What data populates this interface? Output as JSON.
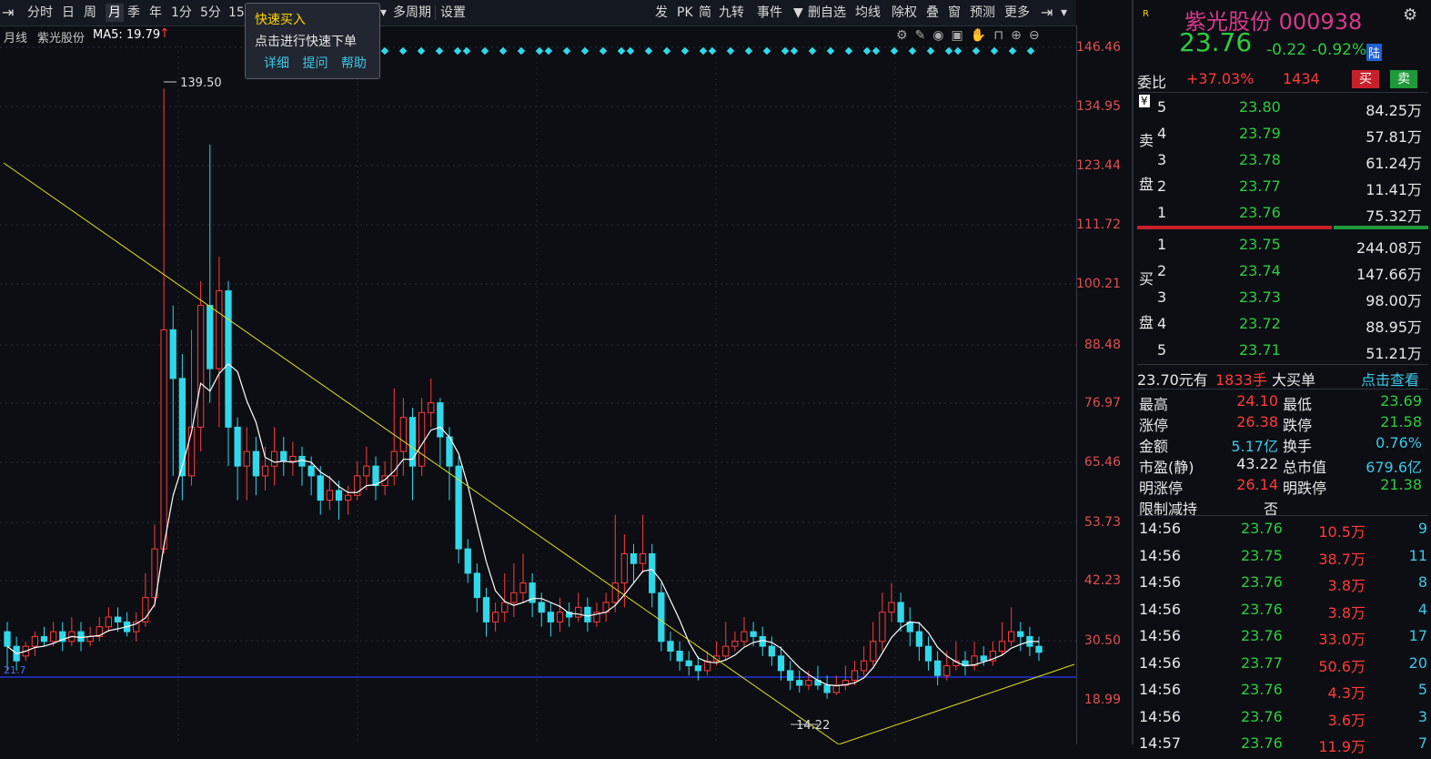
{
  "toolbar": {
    "left_items": [
      "分时",
      "日",
      "周",
      "月",
      "季",
      "年",
      "1分",
      "5分",
      "15"
    ],
    "active_index": 3,
    "mid_items": [
      "多周期",
      "设置"
    ],
    "right_items": [
      "发",
      "PK",
      "简",
      "九转",
      "事件",
      "▼",
      "删自选",
      "均线",
      "除权",
      "叠",
      "窗",
      "预测",
      "更多"
    ]
  },
  "popup": {
    "title": "快速买入",
    "text": "点击进行快速下单",
    "links": [
      "详细",
      "提问",
      "帮助"
    ]
  },
  "info": {
    "period": "月线",
    "stock": "紫光股份",
    "ma": "MA5: 19.79"
  },
  "axis": {
    "ticks": [
      "146.46",
      "134.95",
      "123.44",
      "111.72",
      "100.21",
      "88.48",
      "76.97",
      "65.46",
      "53.73",
      "42.23",
      "30.50",
      "18.99"
    ]
  },
  "annotations": {
    "high": "139.50",
    "low": "14.22",
    "left_price": "21.7"
  },
  "chart_data": {
    "type": "candlestick",
    "ylim": [
      14.0,
      148.0
    ],
    "grid": true,
    "candles": [
      [
        28,
        25,
        30,
        20
      ],
      [
        25,
        22,
        27,
        20
      ],
      [
        23,
        25,
        26,
        22
      ],
      [
        25,
        27,
        28,
        23
      ],
      [
        27,
        26,
        29,
        25
      ],
      [
        26,
        28,
        30,
        25
      ],
      [
        28,
        26,
        30,
        24
      ],
      [
        26,
        28,
        31,
        25
      ],
      [
        28,
        26,
        30,
        24
      ],
      [
        26,
        27,
        29,
        25
      ],
      [
        27,
        29,
        31,
        26
      ],
      [
        29,
        31,
        33,
        28
      ],
      [
        31,
        30,
        33,
        28
      ],
      [
        30,
        28,
        32,
        27
      ],
      [
        28,
        30,
        32,
        26
      ],
      [
        30,
        35,
        40,
        29
      ],
      [
        35,
        45,
        50,
        33
      ],
      [
        45,
        90,
        139.5,
        44
      ],
      [
        90,
        80,
        95,
        60
      ],
      [
        80,
        60,
        85,
        55
      ],
      [
        60,
        70,
        90,
        58
      ],
      [
        70,
        95,
        100,
        65
      ],
      [
        95,
        82,
        128,
        75
      ],
      [
        82,
        98,
        105,
        70
      ],
      [
        98,
        70,
        100,
        62
      ],
      [
        70,
        62,
        72,
        55
      ],
      [
        62,
        65,
        70,
        55
      ],
      [
        65,
        60,
        68,
        56
      ],
      [
        60,
        62,
        66,
        57
      ],
      [
        62,
        65,
        70,
        58
      ],
      [
        65,
        63,
        68,
        60
      ],
      [
        63,
        64,
        67,
        60
      ],
      [
        64,
        62,
        66,
        58
      ],
      [
        62,
        60,
        64,
        56
      ],
      [
        60,
        55,
        62,
        52
      ],
      [
        55,
        57,
        60,
        53
      ],
      [
        57,
        55,
        59,
        51
      ],
      [
        55,
        56,
        58,
        52
      ],
      [
        56,
        60,
        63,
        55
      ],
      [
        60,
        62,
        66,
        57
      ],
      [
        62,
        58,
        64,
        55
      ],
      [
        58,
        60,
        63,
        56
      ],
      [
        60,
        65,
        78,
        58
      ],
      [
        65,
        72,
        76,
        60
      ],
      [
        72,
        62,
        74,
        55
      ],
      [
        62,
        73,
        76,
        60
      ],
      [
        73,
        75,
        80,
        70
      ],
      [
        75,
        68,
        76,
        62
      ],
      [
        68,
        62,
        70,
        55
      ],
      [
        62,
        45,
        64,
        42
      ],
      [
        45,
        40,
        47,
        38
      ],
      [
        40,
        35,
        42,
        32
      ],
      [
        35,
        30,
        37,
        27
      ],
      [
        30,
        32,
        34,
        28
      ],
      [
        32,
        34,
        40,
        30
      ],
      [
        34,
        36,
        42,
        31
      ],
      [
        36,
        38,
        44,
        34
      ],
      [
        38,
        34,
        40,
        31
      ],
      [
        34,
        32,
        36,
        29
      ],
      [
        32,
        30,
        34,
        27
      ],
      [
        30,
        32,
        35,
        28
      ],
      [
        32,
        31,
        34,
        29
      ],
      [
        31,
        33,
        36,
        30
      ],
      [
        33,
        30,
        35,
        28
      ],
      [
        30,
        32,
        34,
        29
      ],
      [
        32,
        34,
        36,
        30
      ],
      [
        34,
        38,
        52,
        32
      ],
      [
        38,
        44,
        48,
        33
      ],
      [
        44,
        42,
        46,
        38
      ],
      [
        42,
        44,
        52,
        40
      ],
      [
        44,
        36,
        46,
        33
      ],
      [
        36,
        26,
        38,
        24
      ],
      [
        26,
        24,
        28,
        22
      ],
      [
        24,
        22,
        26,
        20
      ],
      [
        22,
        21,
        24,
        19
      ],
      [
        21,
        20,
        23,
        18
      ],
      [
        20,
        22,
        24,
        19
      ],
      [
        22,
        23,
        26,
        21
      ],
      [
        23,
        25,
        30,
        22
      ],
      [
        25,
        26,
        28,
        24
      ],
      [
        26,
        28,
        31,
        25
      ],
      [
        28,
        27,
        30,
        25
      ],
      [
        27,
        25,
        29,
        23
      ],
      [
        25,
        23,
        27,
        21
      ],
      [
        23,
        20,
        25,
        18
      ],
      [
        20,
        18,
        22,
        16
      ],
      [
        18,
        17,
        20,
        15.5
      ],
      [
        17,
        18,
        20,
        16
      ],
      [
        18,
        17,
        21,
        16
      ],
      [
        17,
        15.5,
        19,
        14.22
      ],
      [
        15.5,
        17,
        19,
        15
      ],
      [
        17,
        18,
        21,
        16
      ],
      [
        18,
        20,
        22,
        17
      ],
      [
        20,
        22,
        25,
        19
      ],
      [
        22,
        26,
        30,
        21
      ],
      [
        26,
        32,
        36,
        24
      ],
      [
        32,
        34,
        38,
        30
      ],
      [
        34,
        30,
        36,
        28
      ],
      [
        30,
        28,
        33,
        25
      ],
      [
        28,
        25,
        30,
        22
      ],
      [
        25,
        22,
        27,
        20
      ],
      [
        22,
        19,
        24,
        17
      ],
      [
        19,
        21,
        24,
        18
      ],
      [
        21,
        22,
        26,
        20
      ],
      [
        22,
        21,
        24,
        19
      ],
      [
        21,
        23,
        26,
        20
      ],
      [
        23,
        22,
        25,
        21
      ],
      [
        22,
        24,
        26,
        21
      ],
      [
        24,
        26,
        30,
        23
      ],
      [
        26,
        28,
        33,
        25
      ],
      [
        28,
        27,
        30,
        24
      ],
      [
        27,
        25,
        29,
        23
      ],
      [
        25,
        23.76,
        27,
        22
      ]
    ]
  },
  "quote": {
    "name": "紫光股份 000938",
    "price": "23.76",
    "change": "-0.22",
    "pct": "-0.92%",
    "market_tag": "陆",
    "weibi_label": "委比",
    "weibi": "+37.03%",
    "weicha": "1434",
    "buy_btn": "买",
    "sell_btn": "卖",
    "sell_side_labels": [
      "卖",
      "盘"
    ],
    "buy_side_labels": [
      "买",
      "盘"
    ],
    "sells": [
      {
        "lvl": "5",
        "price": "23.80",
        "vol": "84.25万"
      },
      {
        "lvl": "4",
        "price": "23.79",
        "vol": "57.81万"
      },
      {
        "lvl": "3",
        "price": "23.78",
        "vol": "61.24万"
      },
      {
        "lvl": "2",
        "price": "23.77",
        "vol": "11.41万"
      },
      {
        "lvl": "1",
        "price": "23.76",
        "vol": "75.32万"
      }
    ],
    "buys": [
      {
        "lvl": "1",
        "price": "23.75",
        "vol": "244.08万"
      },
      {
        "lvl": "2",
        "price": "23.74",
        "vol": "147.66万"
      },
      {
        "lvl": "3",
        "price": "23.73",
        "vol": "98.00万"
      },
      {
        "lvl": "4",
        "price": "23.72",
        "vol": "88.95万"
      },
      {
        "lvl": "5",
        "price": "23.71",
        "vol": "51.21万"
      }
    ],
    "bigorder": {
      "price": "23.70元有",
      "qty": "1833手",
      "label": "大买单",
      "link": "点击查看"
    },
    "stats": [
      {
        "l1": "最高",
        "v1": "24.10",
        "c1": "red",
        "l2": "最低",
        "v2": "23.69",
        "c2": "green"
      },
      {
        "l1": "涨停",
        "v1": "26.38",
        "c1": "red",
        "l2": "跌停",
        "v2": "21.58",
        "c2": "green"
      },
      {
        "l1": "金额",
        "v1": "5.17亿",
        "c1": "cyan",
        "l2": "换手",
        "v2": "0.76%",
        "c2": "cyan"
      },
      {
        "l1": "市盈(静)",
        "v1": "43.22",
        "c1": "white",
        "l2": "总市值",
        "v2": "679.6亿",
        "c2": "cyan"
      },
      {
        "l1": "明涨停",
        "v1": "26.14",
        "c1": "red",
        "l2": "明跌停",
        "v2": "21.38",
        "c2": "green"
      },
      {
        "l1": "限制减持",
        "v1": "否",
        "c1": "white",
        "l2": "",
        "v2": "",
        "c2": "white"
      }
    ],
    "ticks": [
      {
        "t": "14:56",
        "p": "23.76",
        "a": "10.5万",
        "n": "9"
      },
      {
        "t": "14:56",
        "p": "23.75",
        "a": "38.7万",
        "n": "11"
      },
      {
        "t": "14:56",
        "p": "23.76",
        "a": "3.8万",
        "n": "8"
      },
      {
        "t": "14:56",
        "p": "23.76",
        "a": "3.8万",
        "n": "4"
      },
      {
        "t": "14:56",
        "p": "23.76",
        "a": "33.0万",
        "n": "17"
      },
      {
        "t": "14:56",
        "p": "23.77",
        "a": "50.6万",
        "n": "20"
      },
      {
        "t": "14:56",
        "p": "23.76",
        "a": "4.3万",
        "n": "5"
      },
      {
        "t": "14:56",
        "p": "23.76",
        "a": "3.6万",
        "n": "3"
      },
      {
        "t": "14:57",
        "p": "23.76",
        "a": "11.9万",
        "n": "7"
      }
    ]
  }
}
